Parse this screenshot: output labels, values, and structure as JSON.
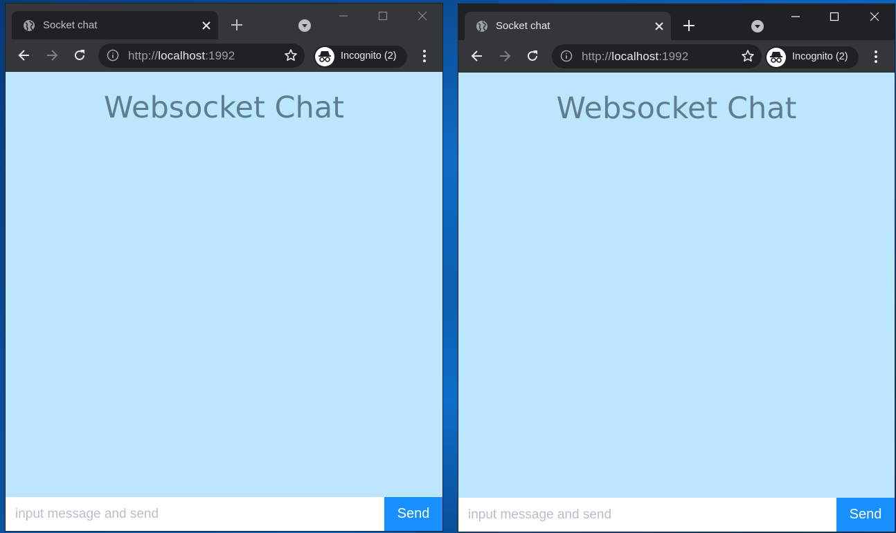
{
  "windows": [
    {
      "tab": {
        "title": "Socket chat"
      },
      "omnibox": {
        "scheme": "http://",
        "host": "localhost",
        "port": ":1992"
      },
      "incognito": {
        "label": "Incognito (2)"
      },
      "page": {
        "title": "Websocket Chat",
        "input_placeholder": "input message and send",
        "send_label": "Send"
      }
    },
    {
      "tab": {
        "title": "Socket chat"
      },
      "omnibox": {
        "scheme": "http://",
        "host": "localhost",
        "port": ":1992"
      },
      "incognito": {
        "label": "Incognito (2)"
      },
      "page": {
        "title": "Websocket Chat",
        "input_placeholder": "input message and send",
        "send_label": "Send"
      }
    }
  ],
  "icons": {
    "favicon": "globe-icon",
    "tab_close": "close-icon",
    "new_tab": "plus-icon",
    "tab_search": "chevron-down-circle-icon",
    "back": "arrow-left-icon",
    "forward": "arrow-right-icon",
    "reload": "reload-icon",
    "info": "info-icon",
    "bookmark": "star-icon",
    "incognito": "incognito-icon",
    "menu": "kebab-menu-icon",
    "minimize": "minimize-icon",
    "maximize": "maximize-icon",
    "close_window": "close-window-icon"
  },
  "colors": {
    "page_background": "#bbe6fd",
    "title_text": "#5f7d8e",
    "send_button": "#1890ff",
    "chrome_dark": "#202124",
    "chrome_toolbar": "#35363a"
  }
}
